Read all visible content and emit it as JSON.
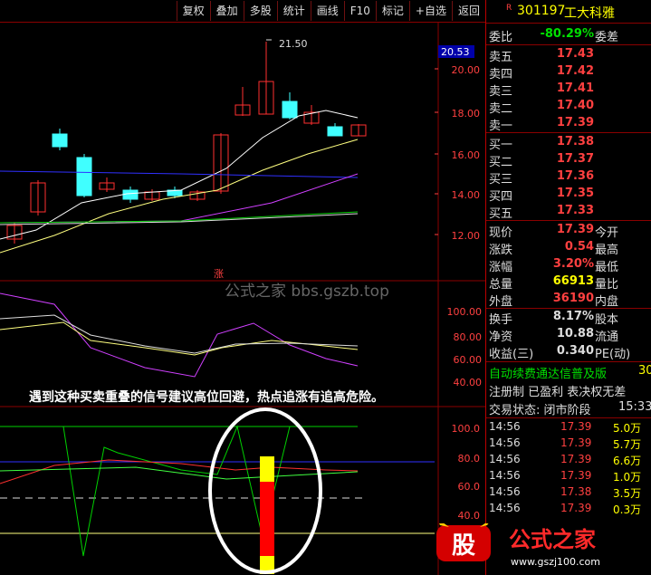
{
  "toolbar": {
    "items": [
      "复权",
      "叠加",
      "多股",
      "统计",
      "画线",
      "F10",
      "标记",
      "+自选",
      "返回"
    ]
  },
  "stock": {
    "badge": "R",
    "code": "301197",
    "name": "工大科雅"
  },
  "weibi": {
    "label": "委比",
    "value": "-80.29%",
    "label2": "委差"
  },
  "sell": [
    {
      "label": "卖五",
      "price": "17.43"
    },
    {
      "label": "卖四",
      "price": "17.42"
    },
    {
      "label": "卖三",
      "price": "17.41"
    },
    {
      "label": "卖二",
      "price": "17.40"
    },
    {
      "label": "卖一",
      "price": "17.39"
    }
  ],
  "buy": [
    {
      "label": "买一",
      "price": "17.38"
    },
    {
      "label": "买二",
      "price": "17.37"
    },
    {
      "label": "买三",
      "price": "17.36"
    },
    {
      "label": "买四",
      "price": "17.35"
    },
    {
      "label": "买五",
      "price": "17.33"
    }
  ],
  "quote": [
    {
      "l": "现价",
      "v": "17.39",
      "r": "今开"
    },
    {
      "l": "涨跌",
      "v": "0.54",
      "r": "最高"
    },
    {
      "l": "涨幅",
      "v": "3.20%",
      "r": "最低"
    },
    {
      "l": "总量",
      "v": "66913",
      "r": "量比"
    },
    {
      "l": "外盘",
      "v": "36190",
      "r": "内盘"
    }
  ],
  "quote2": [
    {
      "l": "换手",
      "v": "8.17%",
      "r": "股本"
    },
    {
      "l": "净资",
      "v": "10.88",
      "r": "流通"
    },
    {
      "l": "收益(三)",
      "v": "0.340",
      "r": "PE(动)"
    }
  ],
  "info": {
    "line1": "自动续费通达信普及版",
    "line1b": "30",
    "line2": "注册制 已盈利 表决权无差",
    "line3": "交易状态: 闭市阶段",
    "line3b": "15:33:"
  },
  "ticks": [
    {
      "t": "14:56",
      "p": "17.39",
      "v": "5.0万"
    },
    {
      "t": "14:56",
      "p": "17.39",
      "v": "5.7万"
    },
    {
      "t": "14:56",
      "p": "17.39",
      "v": "6.6万"
    },
    {
      "t": "14:56",
      "p": "17.39",
      "v": "1.0万"
    },
    {
      "t": "14:56",
      "p": "17.38",
      "v": "3.5万"
    },
    {
      "t": "14:56",
      "p": "17.39",
      "v": "0.3万"
    }
  ],
  "chart": {
    "price_axis": [
      "20.00",
      "18.00",
      "16.00",
      "14.00",
      "12.00"
    ],
    "last_price_tag": "20.53",
    "high_label": "21.50",
    "zhang_marker": "涨",
    "mid_axis": [
      "100.00",
      "80.00",
      "60.00",
      "40.00"
    ],
    "bottom_axis": [
      "100.0",
      "80.0",
      "60.0",
      "40.0"
    ],
    "note": "遇到这种买卖重叠的信号建议高位回避，热点追涨有追高危险。",
    "watermark": "公式之家 bbs.gszb.top",
    "logo_text": "公式之家",
    "logo_url": "www.gszj100.com",
    "logo_badge": "股"
  }
}
